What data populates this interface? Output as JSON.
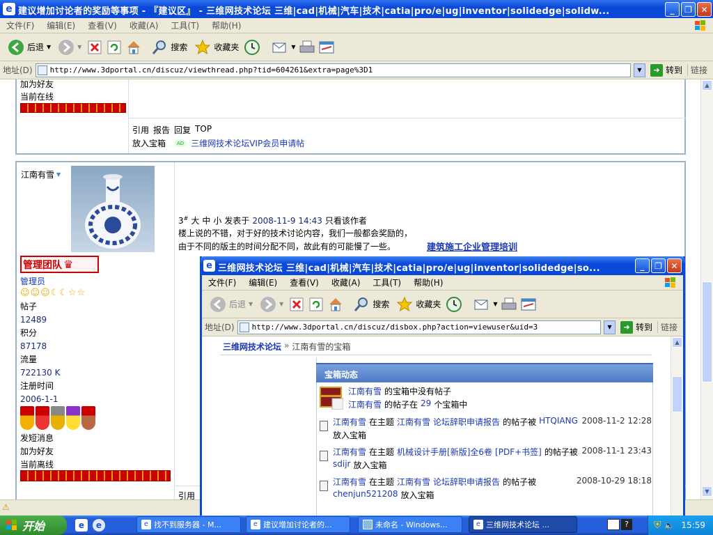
{
  "main_window": {
    "title": "建议增加讨论者的奖励等事项 - 『建议区』 - 三维网技术论坛 三维|cad|机械|汽车|技术|catia|pro/e|ug|inventor|solidedge|solidw...",
    "menu": [
      "文件(F)",
      "编辑(E)",
      "查看(V)",
      "收藏(A)",
      "工具(T)",
      "帮助(H)"
    ],
    "toolbar": {
      "back": "后退",
      "search": "搜索",
      "favorites": "收藏夹"
    },
    "address": {
      "label": "地址(D)",
      "url": "http://www.3dportal.cn/discuz/viewthread.php?tid=604261&extra=page%3D1",
      "go": "转到",
      "links": "链接"
    }
  },
  "post1": {
    "add_friend": "加为好友",
    "online": "当前在线",
    "actions": [
      "引用",
      "报告",
      "回复",
      "TOP"
    ],
    "bottom": "放入宝箱",
    "ad_badge": "AD",
    "vip_link": "三维网技术论坛VIP会员申请帖"
  },
  "post2": {
    "username": "江南有雪",
    "badge": "管理团队",
    "role": "管理员",
    "stats": [
      {
        "label": "帖子",
        "value": "12489"
      },
      {
        "label": "积分",
        "value": "87178"
      },
      {
        "label": "流量",
        "value": "722130 K"
      },
      {
        "label": "注册时间",
        "value": "2006-1-1"
      }
    ],
    "send_msg": "发短消息",
    "add_friend": "加为好友",
    "online": "当前离线",
    "floor": "3",
    "floor_sup": "#",
    "font_sizes": [
      "大",
      "中",
      "小"
    ],
    "posted_at_label": "发表于",
    "posted_at": "2008-11-9 14:43",
    "only_author": "只看该作者",
    "content": [
      "楼上说的不错，对于好的技术讨论内容，我们一般都会奖励的，",
      "由于不同的版主的时间分配不同，故此有的可能慢了一些。"
    ],
    "ad": "建筑施工企业管理培训",
    "quote": "引用"
  },
  "popup": {
    "title": "三维网技术论坛 三维|cad|机械|汽车|技术|catia|pro/e|ug|inventor|solidedge|so...",
    "menu": [
      "文件(F)",
      "编辑(E)",
      "查看(V)",
      "收藏(A)",
      "工具(T)",
      "帮助(H)"
    ],
    "toolbar": {
      "back": "后退",
      "search": "搜索",
      "favorites": "收藏夹"
    },
    "address": {
      "label": "地址(D)",
      "url": "http://www.3dportal.cn/discuz/disbox.php?action=viewuser&uid=3",
      "go": "转到",
      "links": "链接"
    },
    "breadcrumb": {
      "site": "三维网技术论坛",
      "sep": "»",
      "page": "江南有雪的宝箱"
    },
    "panel_title": "宝箱动态",
    "summary": [
      {
        "user": "江南有雪",
        "text": "的宝箱中没有帖子"
      },
      {
        "user": "江南有雪",
        "text_a": "的帖子在",
        "count": "29",
        "text_b": "个宝箱中"
      }
    ],
    "activities": [
      {
        "user": "江南有雪",
        "p1": "在主题",
        "owner": "江南有雪",
        "topic": "论坛辞职申请报告",
        "p2": "的帖子被",
        "actor": "HTQIANG",
        "action": "放入宝箱",
        "time": "2008-11-2 12:28"
      },
      {
        "user": "江南有雪",
        "p1": "在主题",
        "owner": "",
        "topic": "机械设计手册[新版]全6卷",
        "extra": "[PDF+书签]",
        "p2": "的帖子被",
        "actor": "sdijr",
        "action": "放入宝箱",
        "time": "2008-11-1 23:43"
      },
      {
        "user": "江南有雪",
        "p1": "在主题",
        "owner": "江南有雪",
        "topic": "论坛辞职申请报告",
        "p2": "的帖子被",
        "actor": "chenjun521208",
        "action": "放入宝箱",
        "time": "2008-10-29 18:18"
      }
    ]
  },
  "taskbar": {
    "start": "开始",
    "tasks": [
      "找不到服务器 - M...",
      "建议增加讨论者的...",
      "未命名 - Windows...",
      "三维网技术论坛 ..."
    ],
    "clock": "15:59"
  },
  "colors": {
    "titlebar": "#0a48d8",
    "chrome": "#ece9d8",
    "taskbar": "#245edb",
    "start": "#3c9a3c",
    "link": "#1a38b8",
    "red": "#cc0000"
  }
}
